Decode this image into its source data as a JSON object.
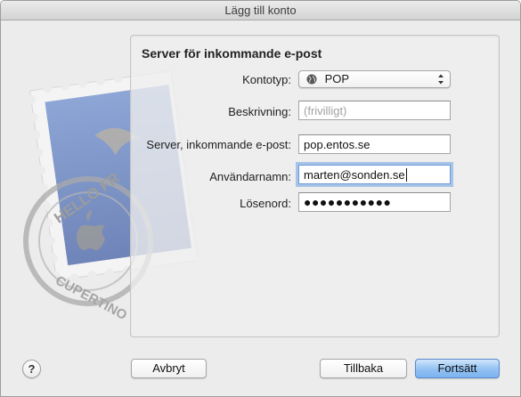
{
  "window": {
    "title": "Lägg till konto"
  },
  "panel": {
    "title": "Server för inkommande e-post"
  },
  "stamp": {
    "text_top": "HELLO FR",
    "text_bottom": "CUPERTINO"
  },
  "form": {
    "account_type": {
      "label": "Kontotyp:",
      "value": "POP",
      "icon": "globe-icon"
    },
    "description": {
      "label": "Beskrivning:",
      "value": "",
      "placeholder": "(frivilligt)"
    },
    "incoming_server": {
      "label": "Server, inkommande e-post:",
      "value": "pop.entos.se"
    },
    "username": {
      "label": "Användarnamn:",
      "value": "marten@sonden.se"
    },
    "password": {
      "label": "Lösenord:",
      "value": "●●●●●●●●●●●"
    }
  },
  "buttons": {
    "help": "?",
    "cancel": "Avbryt",
    "back": "Tillbaka",
    "continue": "Fortsätt"
  },
  "colors": {
    "default_button": "#7cb3ef",
    "focus_ring": "#6d9ad8",
    "window_bg": "#ececec"
  }
}
